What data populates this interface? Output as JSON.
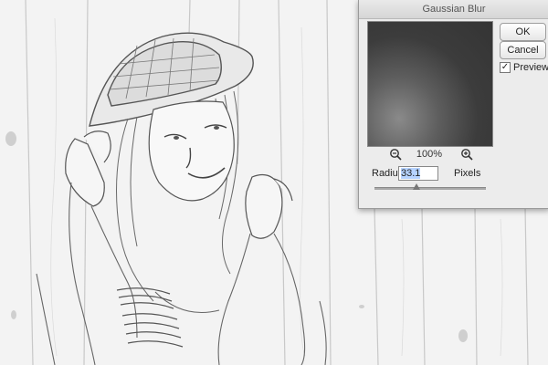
{
  "dialog": {
    "title": "Gaussian Blur",
    "ok_label": "OK",
    "cancel_label": "Cancel",
    "preview_label": "Preview",
    "preview_checked": true,
    "zoom": "100%",
    "radius_label": "Radius:",
    "radius_value": "33.1",
    "radius_unit": "Pixels",
    "slider_level": 0.38
  },
  "icons": {
    "zoom_out": "zoom-out-icon",
    "zoom_in": "zoom-in-icon",
    "check": "✓"
  },
  "colors": {
    "dialog_bg": "#ececec",
    "selection": "#b6d3ff",
    "canvas_bg": "#f4f4f4"
  }
}
